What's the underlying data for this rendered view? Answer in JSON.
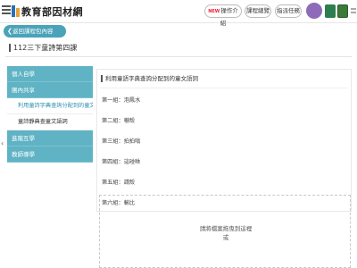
{
  "header": {
    "site_title": "教育部因材網",
    "new_tag": "NEW",
    "buttons": [
      "操作介紹",
      "課程總覽",
      "指派任務"
    ]
  },
  "back_button": {
    "label": "返回課程包內容"
  },
  "course": {
    "title": "112三下童詩第四課"
  },
  "sidebar": {
    "items": [
      {
        "label": "個人自學",
        "type": "category"
      },
      {
        "label": "團內共享",
        "type": "category"
      },
      {
        "label": "利用童詩字典查詢分配到的童文語詞",
        "type": "sub",
        "active": true
      },
      {
        "label": "童詩靜典查童文語詞",
        "type": "sub",
        "active": false
      },
      {
        "label": "進階互學",
        "type": "category"
      },
      {
        "label": "教師導學",
        "type": "category"
      }
    ]
  },
  "panel": {
    "title": "利用童語字典查詢分配到的童文語詞",
    "groups": [
      "第一組：泡鳳水",
      "第二組：嚇殼",
      "第三組：拍拍嗡",
      "第四組：這碰咻",
      "第五組：請殼",
      "第六組：輸比"
    ]
  },
  "upload": {
    "line1": "請將檔案拖曳到這裡",
    "line2": "或"
  },
  "colors": {
    "accent": "#5fb3c4",
    "back_button": "#4aa3b8",
    "avatar": "#8e6bb8"
  }
}
